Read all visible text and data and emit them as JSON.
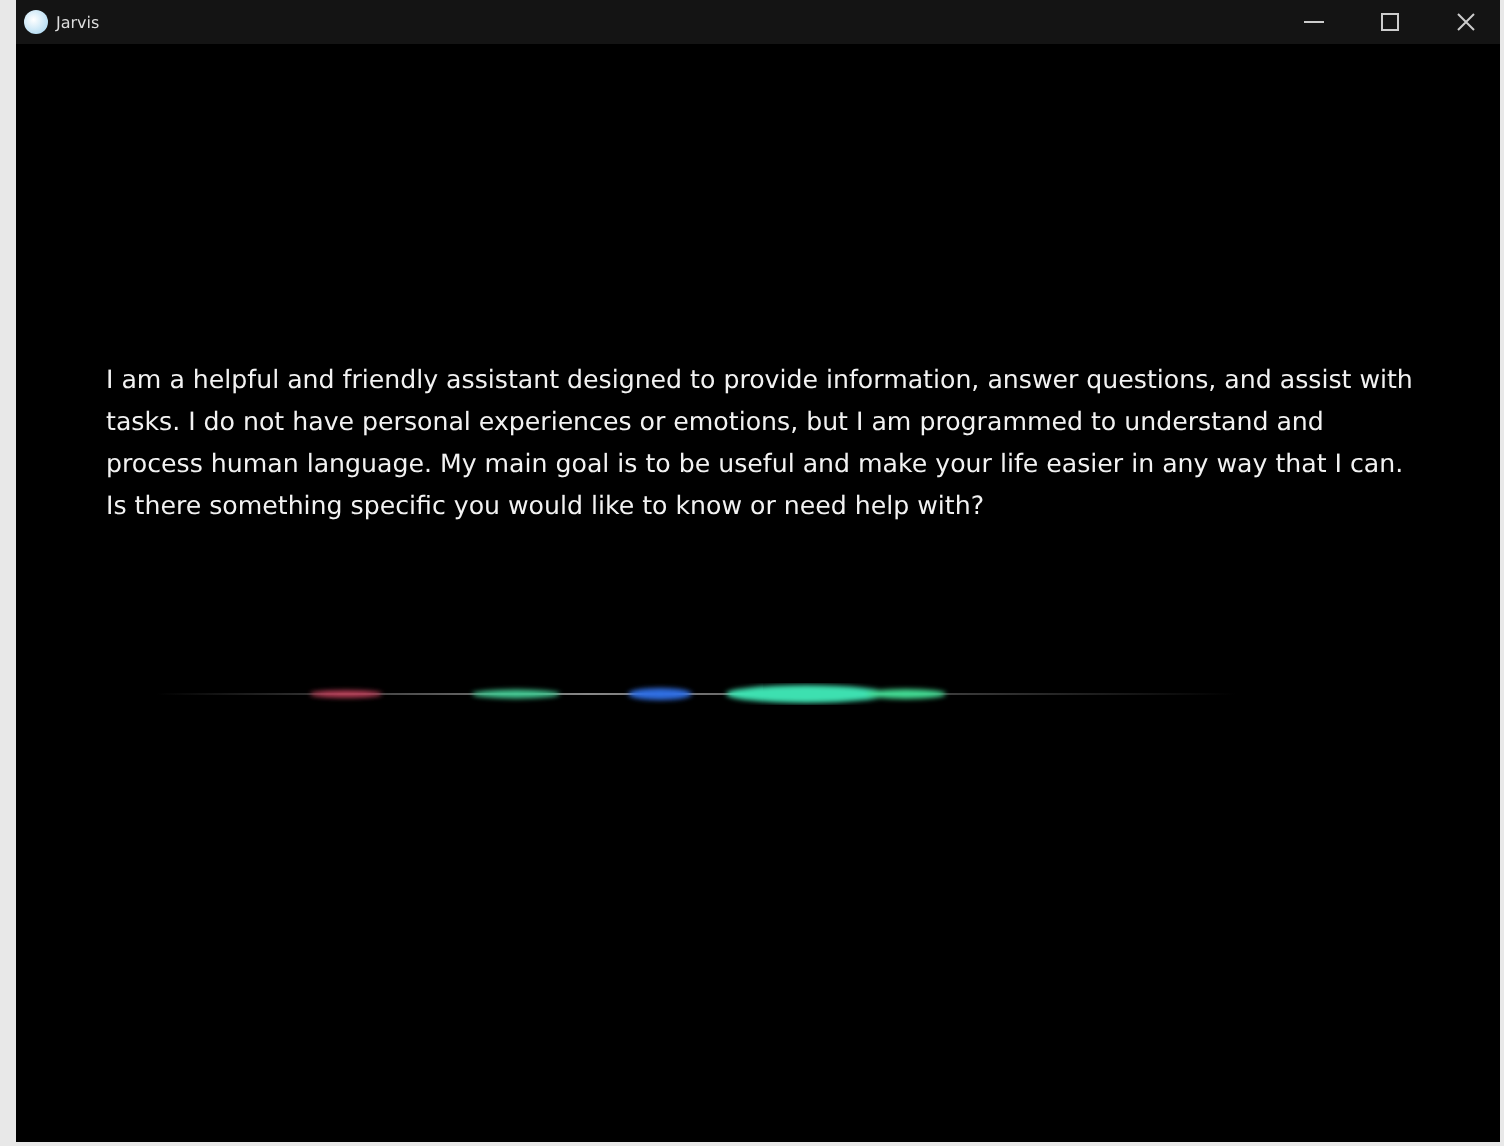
{
  "window": {
    "title": "Jarvis"
  },
  "response": {
    "text": "I am a helpful and friendly assistant designed to provide information, answer questions, and assist with tasks. I do not have personal experiences or emotions, but I am programmed to understand and process human language. My main goal is to be useful and make your life easier in any way that I can. Is there something specific you would like to know or need help with?"
  }
}
